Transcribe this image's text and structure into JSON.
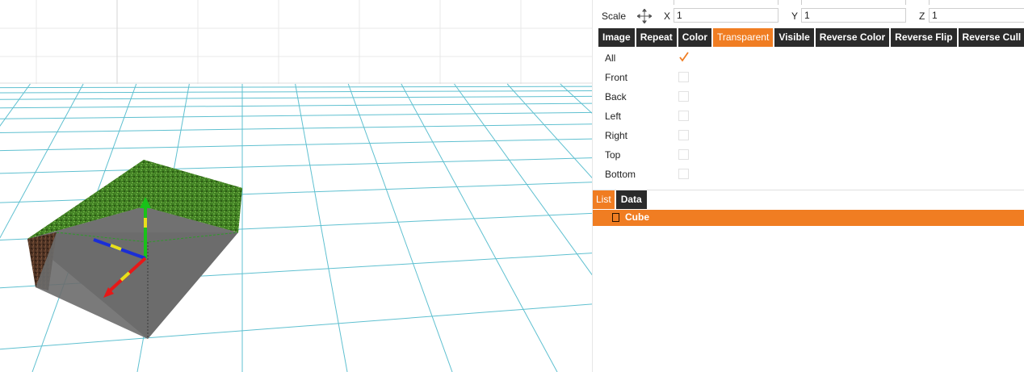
{
  "scale": {
    "label": "Scale",
    "x_label": "X",
    "x_value": "1",
    "y_label": "Y",
    "y_value": "1",
    "z_label": "Z",
    "z_value": "1",
    "icon": "move-arrows-icon"
  },
  "tabs": [
    {
      "label": "Image",
      "active": false
    },
    {
      "label": "Repeat",
      "active": false
    },
    {
      "label": "Color",
      "active": false
    },
    {
      "label": "Transparent",
      "active": true
    },
    {
      "label": "Visible",
      "active": false
    },
    {
      "label": "Reverse Color",
      "active": false
    },
    {
      "label": "Reverse Flip",
      "active": false
    },
    {
      "label": "Reverse Cull",
      "active": false
    }
  ],
  "faces": [
    {
      "label": "All",
      "checked": true
    },
    {
      "label": "Front",
      "checked": false
    },
    {
      "label": "Back",
      "checked": false
    },
    {
      "label": "Left",
      "checked": false
    },
    {
      "label": "Right",
      "checked": false
    },
    {
      "label": "Top",
      "checked": false
    },
    {
      "label": "Bottom",
      "checked": false
    }
  ],
  "list_tabs": [
    {
      "label": "List",
      "active": true
    },
    {
      "label": "Data",
      "active": false
    }
  ],
  "objects": [
    {
      "label": "Cube",
      "icon": "cube-icon",
      "selected": true
    }
  ],
  "colors": {
    "accent": "#f07d22",
    "tab_bg": "#2b2b2b",
    "grid": "#5fc0d0",
    "grass": "#3f7d22",
    "dirt": "#5a3a28",
    "inner": "#707070"
  }
}
